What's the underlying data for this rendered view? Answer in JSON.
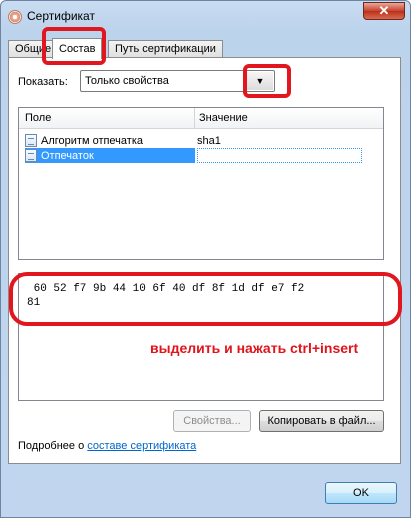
{
  "window": {
    "title": "Сертификат",
    "close_label": "✕"
  },
  "tabs": [
    {
      "label": "Общие",
      "active": false
    },
    {
      "label": "Состав",
      "active": true
    },
    {
      "label": "Путь сертификации",
      "active": false
    }
  ],
  "filter": {
    "label": "Показать:",
    "selected": "Только свойства",
    "arrow_icon": "▼"
  },
  "list": {
    "columns": [
      "Поле",
      "Значение"
    ],
    "rows": [
      {
        "field": "Алгоритм отпечатка",
        "value": "sha1",
        "selected": false
      },
      {
        "field": "Отпечаток",
        "value": "",
        "selected": true
      }
    ]
  },
  "detail": {
    "line1": " 60 52 f7 9b 44 10 6f 40 df 8f 1d df e7 f2",
    "line2": "81"
  },
  "annotation": "выделить и нажать ctrl+insert",
  "buttons": {
    "properties": "Свойства...",
    "copy_to_file": "Копировать в файл...",
    "ok": "OK"
  },
  "more_info": {
    "prefix": "Подробнее о ",
    "link": "составе сертификата"
  },
  "colors": {
    "highlight": "#e2161e",
    "selection": "#3399ff",
    "link": "#0066cc"
  }
}
